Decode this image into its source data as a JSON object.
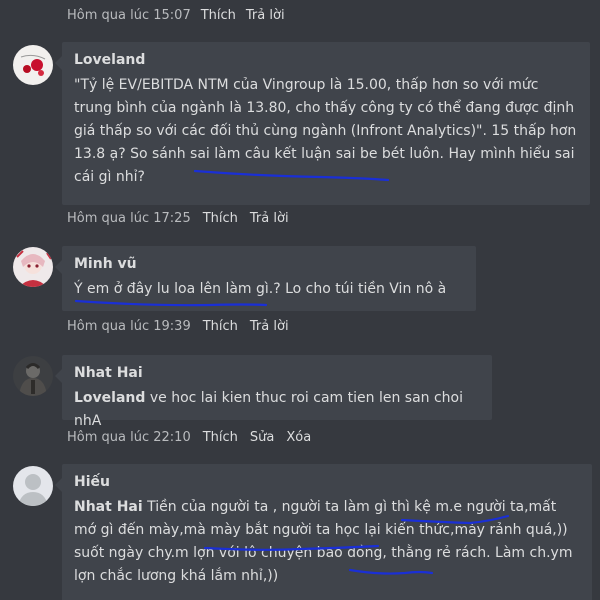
{
  "prev_comment": {
    "time": "Hôm qua lúc 15:07",
    "like": "Thích",
    "reply": "Trả lời"
  },
  "comments": [
    {
      "author": "Loveland",
      "text": "\"Tỷ lệ EV/EBITDA NTM của Vingroup là 15.00, thấp hơn so với mức trung bình của ngành là 13.80, cho thấy công ty có thể đang được định giá thấp so với các đối thủ cùng ngành (Infront Analytics)\". 15 thấp hơn 13.8 ạ? So sánh sai làm câu kết luận sai be bét luôn. Hay mình hiểu sai cái gì nhỉ?",
      "time": "Hôm qua lúc 17:25",
      "like": "Thích",
      "reply": "Trả lời"
    },
    {
      "author": "Minh vũ",
      "text": "Ý em ở đây lu loa lên làm gì.? Lo cho túi tiền Vin nô à",
      "time": "Hôm qua lúc 19:39",
      "like": "Thích",
      "reply": "Trả lời"
    },
    {
      "author": "Nhat Hai",
      "mention": "Loveland",
      "text": " ve hoc lai kien thuc roi cam tien len san choi nhA",
      "time": "Hôm qua lúc 22:10",
      "like": "Thích",
      "edit": "Sửa",
      "delete": "Xóa"
    },
    {
      "author": "Hiếu",
      "mention": "Nhat Hai",
      "text": " Tiền của người ta , người ta làm gì thì kệ m.e người ta,mất mớ gì đến mày,mà mày bắt người ta học lại kiến thức,mày rảnh quá,)) suốt ngày chy.m lợn với lô chuyện bao đồng, thằng rẻ rách. Làm ch.ym lợn chắc lương khá lắm nhỉ,))"
    }
  ],
  "colors": {
    "background": "#36393f",
    "bubble": "#40444b",
    "text": "#dcddde",
    "meta": "#b9bbbe",
    "annotation": "#1a2fd6"
  }
}
